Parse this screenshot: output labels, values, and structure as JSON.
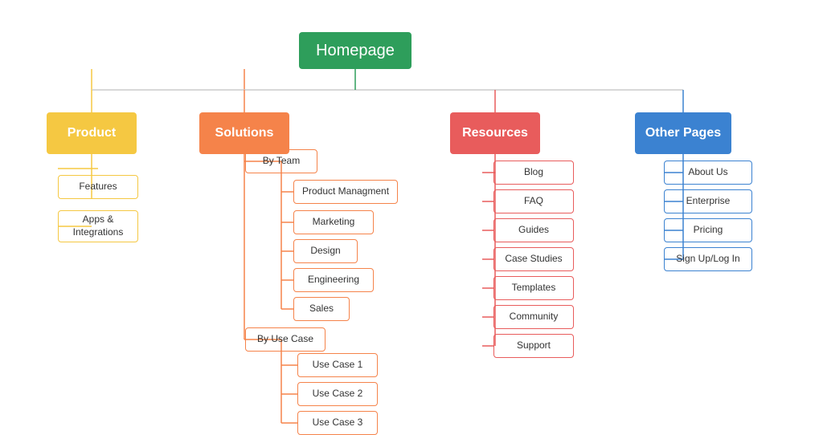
{
  "nodes": {
    "homepage": "Homepage",
    "product": "Product",
    "solutions": "Solutions",
    "resources": "Resources",
    "otherpages": "Other Pages",
    "features": "Features",
    "apps": "Apps & Integrations",
    "byteam": "By Team",
    "pm": "Product Managment",
    "marketing": "Marketing",
    "design": "Design",
    "engineering": "Engineering",
    "sales": "Sales",
    "byusecase": "By Use Case",
    "uc1": "Use Case 1",
    "uc2": "Use Case 2",
    "uc3": "Use Case 3",
    "blog": "Blog",
    "faq": "FAQ",
    "guides": "Guides",
    "casestudies": "Case Studies",
    "templates": "Templates",
    "community": "Community",
    "support": "Support",
    "aboutus": "About Us",
    "enterprise": "Enterprise",
    "pricing": "Pricing",
    "signup": "Sign Up/Log In"
  },
  "colors": {
    "homepage": "#2e9e5b",
    "product": "#f5c842",
    "solutions": "#f5834a",
    "resources": "#e85c5c",
    "otherpages": "#3b82d1"
  }
}
